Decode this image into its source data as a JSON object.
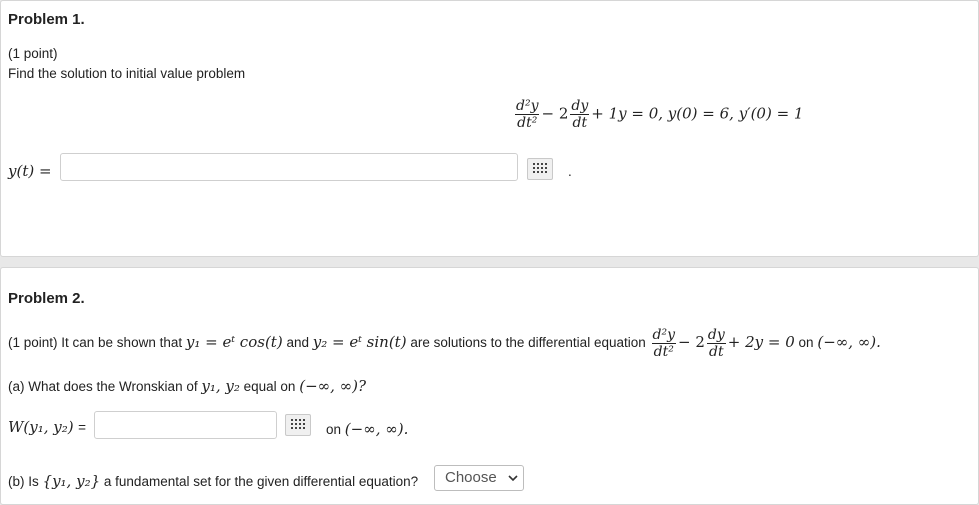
{
  "problem1": {
    "title": "Problem 1.",
    "points": "(1 point)",
    "prompt": "Find the solution to initial value problem",
    "eq_num": "d²y",
    "eq_den": "dt²",
    "eq_mid1": "− 2",
    "eq_num2": "dy",
    "eq_den2": "dt",
    "eq_rest": "+ 1y = 0,   y(0) = 6, y′(0) = 1",
    "answer_label": "y(t) =",
    "answer_value": "",
    "period": "."
  },
  "problem2": {
    "title": "Problem 2.",
    "intro_prefix": "(1 point) It can be shown that",
    "y1": "y₁ = eᵗ cos(t)",
    "and": "and",
    "y2": "y₂ = eᵗ sin(t)",
    "intro_middle": "are solutions to the differential equation",
    "eq_num": "d²y",
    "eq_den": "dt²",
    "eq_mid1": "− 2",
    "eq_num2": "dy",
    "eq_den2": "dt",
    "eq_rest": "+ 2y = 0",
    "on": "on",
    "interval": "(−∞, ∞).",
    "part_a_prefix": "(a) What does the Wronskian of",
    "part_a_vars": "y₁, y₂",
    "part_a_mid": "equal on",
    "part_a_interval": "(−∞, ∞)?",
    "wronskian_label": "W(y₁, y₂)",
    "wronskian_eq": "=",
    "wronskian_value": "",
    "on_after": "on",
    "interval_after": "(−∞, ∞).",
    "part_b_prefix": "(b) Is",
    "part_b_set": "{y₁, y₂}",
    "part_b_suffix": "a fundamental set for the given differential equation?",
    "select_value": "Choose"
  },
  "icons": {
    "keyboard": "keyboard-grid-icon",
    "chevron": "chevron-down-icon"
  }
}
